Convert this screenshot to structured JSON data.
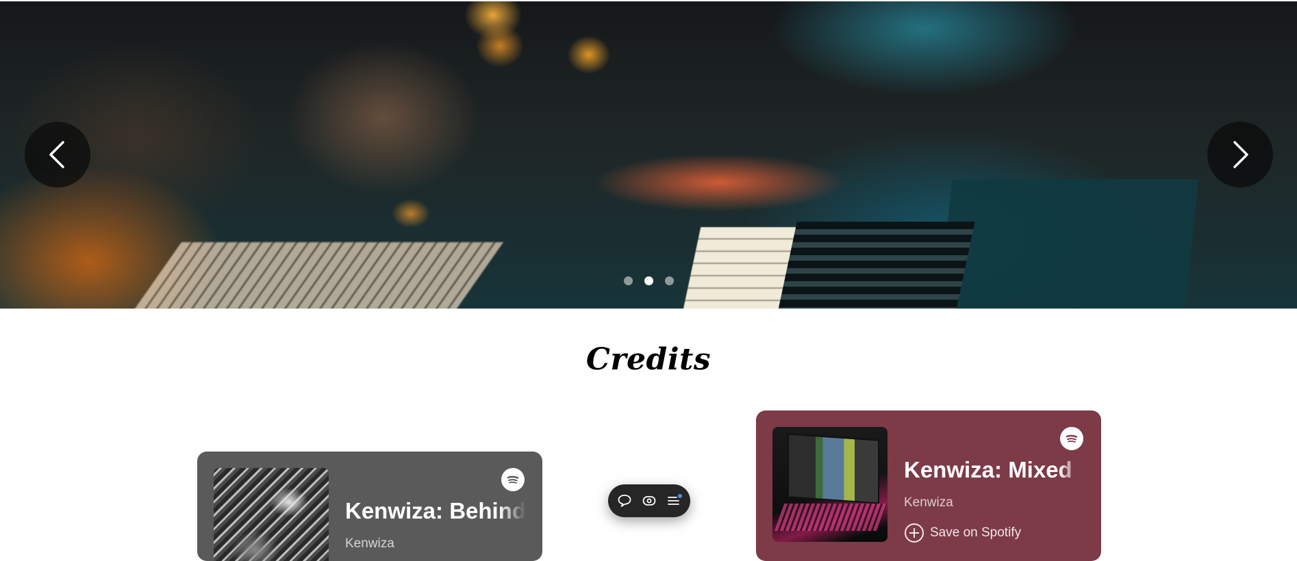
{
  "hero": {
    "slide_count": 3,
    "active_slide_index": 1,
    "prev_icon": "chevron-left-icon",
    "next_icon": "chevron-right-icon"
  },
  "credits": {
    "heading": "Credits",
    "cards": [
      {
        "title": "Kenwiza: Behind",
        "artist": "Kenwiza",
        "background_color": "#5a5a5a",
        "brand_icon": "spotify-icon"
      },
      {
        "title": "Kenwiza: Mixed",
        "artist": "Kenwiza",
        "save_label": "Save on Spotify",
        "background_color": "#7d3a47",
        "brand_icon": "spotify-icon"
      }
    ]
  },
  "toolbar": {
    "icons": [
      "comment-icon",
      "preview-icon",
      "menu-icon"
    ],
    "background_color": "#262626",
    "notification_color": "#4a90e2"
  }
}
